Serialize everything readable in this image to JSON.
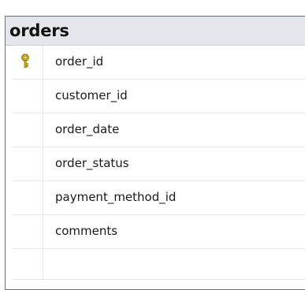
{
  "table": {
    "title": "orders",
    "primary_key_icon": "key-icon",
    "columns": [
      {
        "name": "order_id",
        "primary_key": true
      },
      {
        "name": "customer_id",
        "primary_key": false
      },
      {
        "name": "order_date",
        "primary_key": false
      },
      {
        "name": "order_status",
        "primary_key": false
      },
      {
        "name": "payment_method_id",
        "primary_key": false
      },
      {
        "name": "comments",
        "primary_key": false
      }
    ]
  },
  "colors": {
    "title_bar": "#e3e6ea",
    "border": "#6f6f6f",
    "key_icon": "#d8b400"
  }
}
